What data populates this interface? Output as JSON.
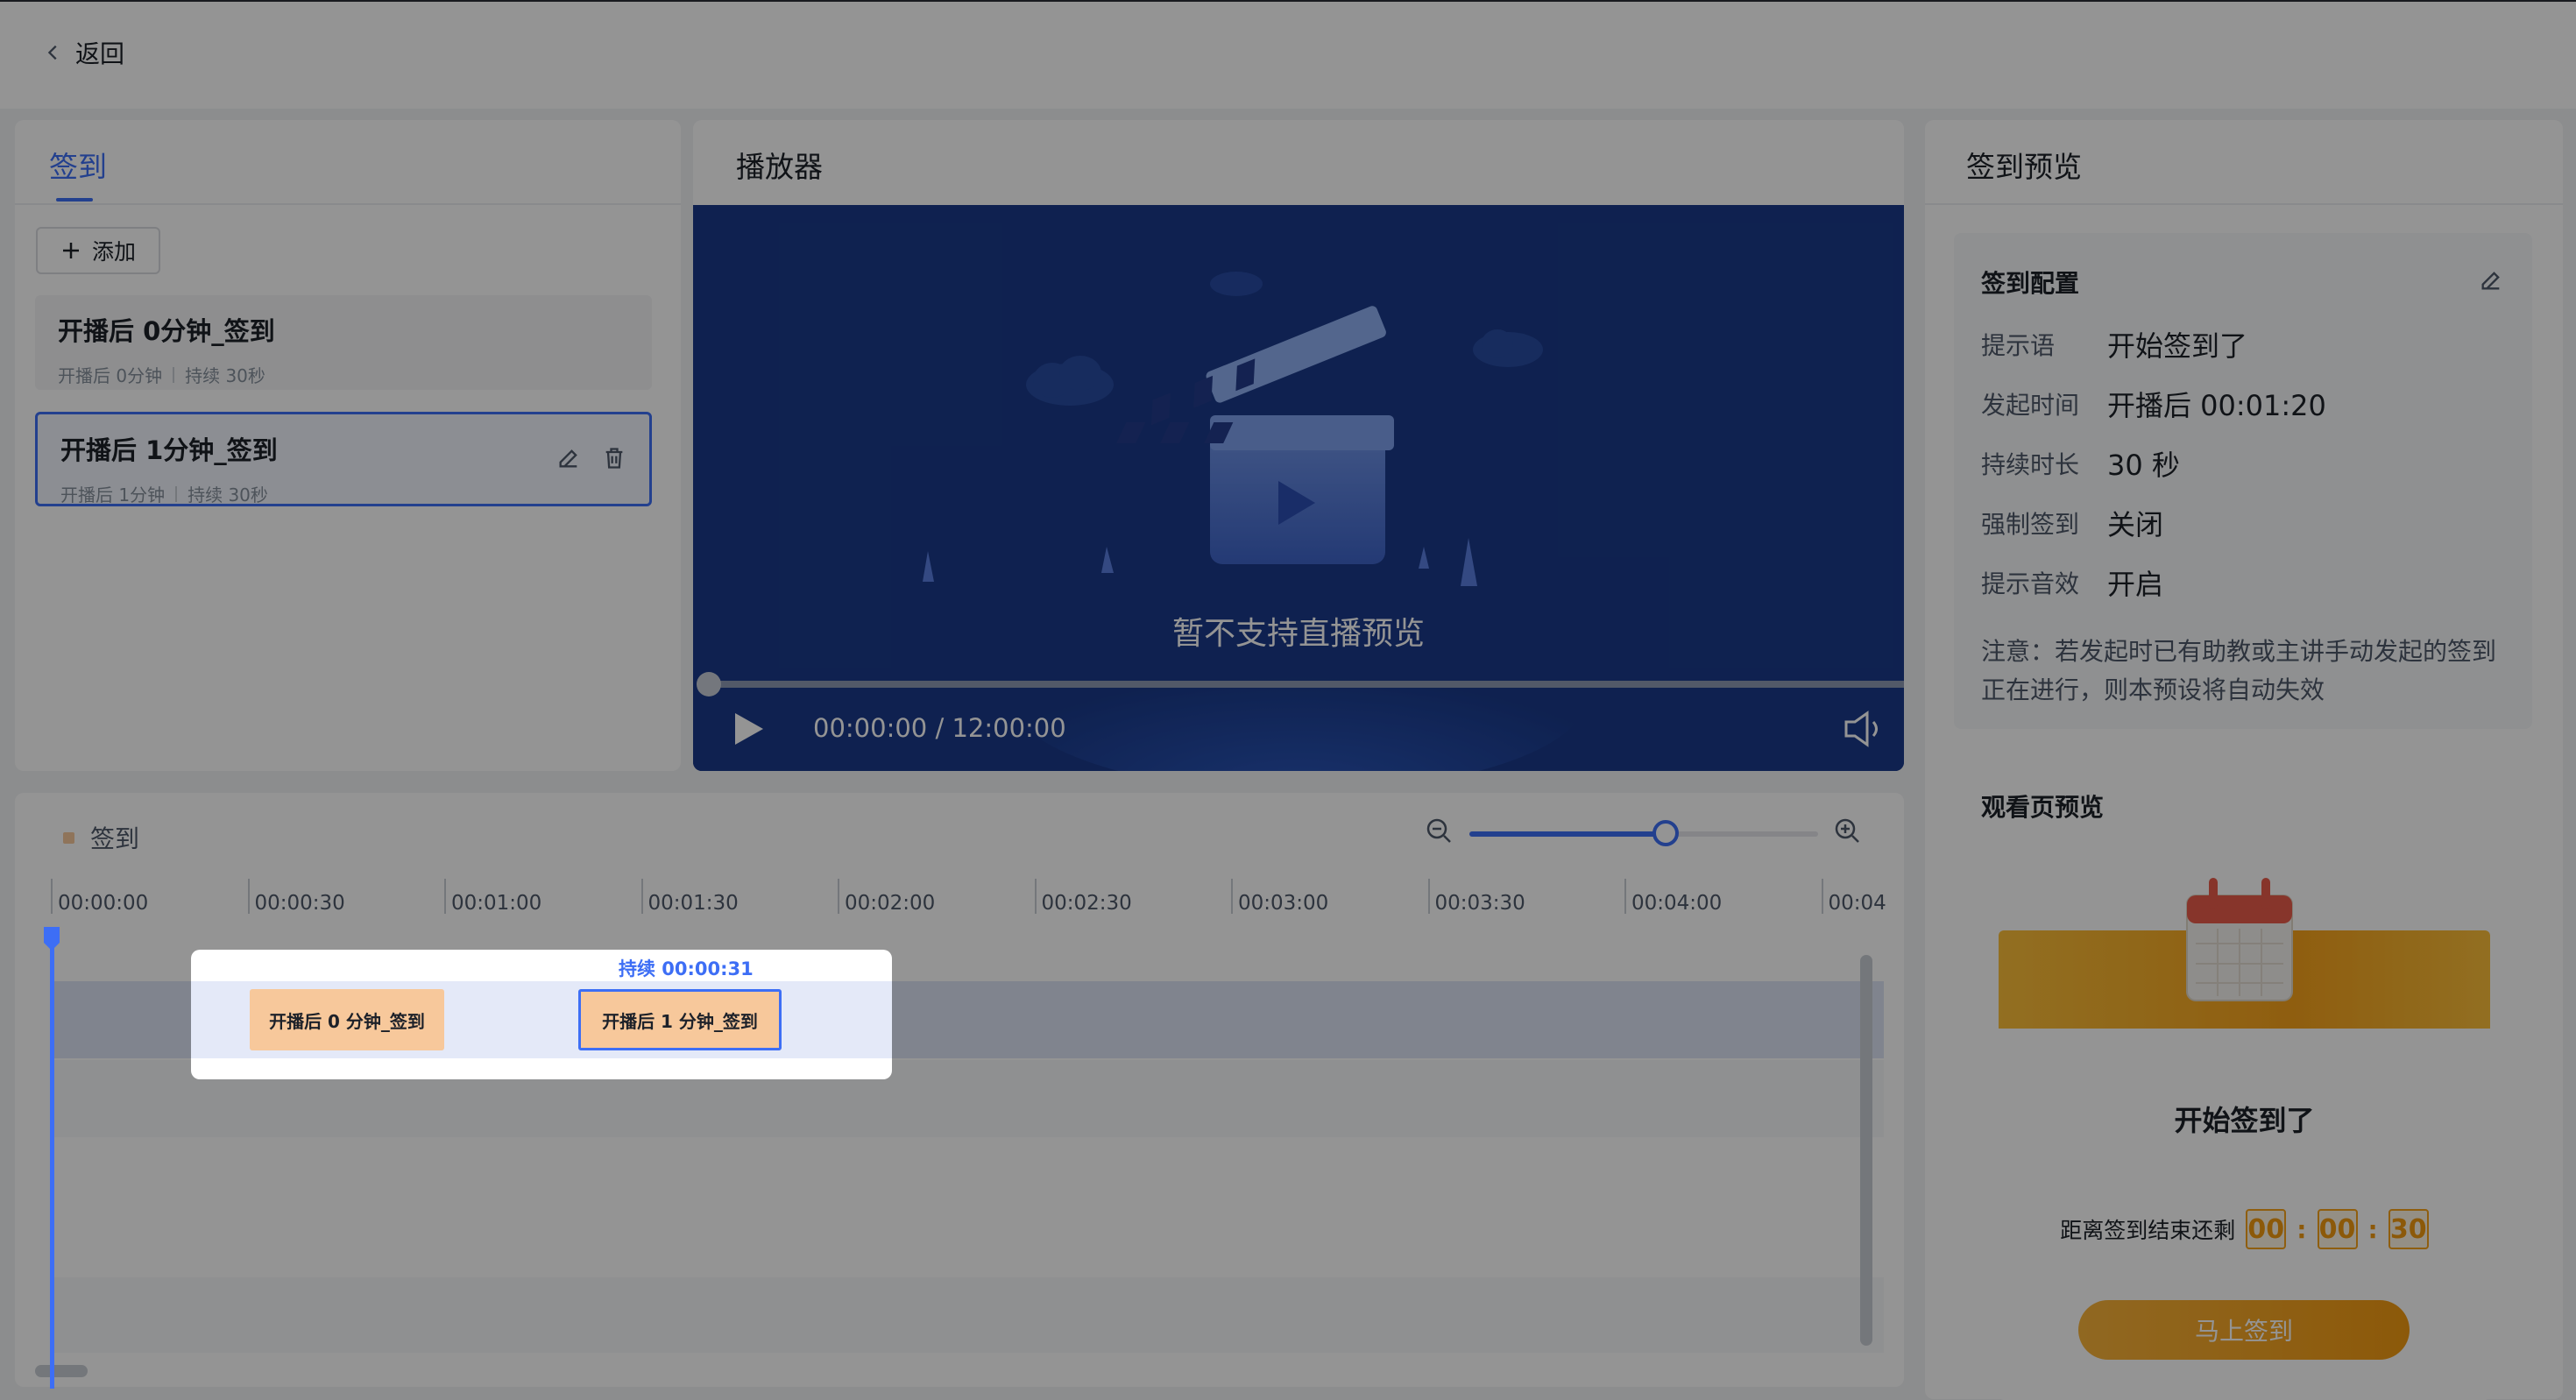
{
  "header": {
    "back_label": "返回"
  },
  "left_panel": {
    "tab_label": "签到",
    "add_label": "添加",
    "items": [
      {
        "title": "开播后 0分钟_签到",
        "start": "开播后 0分钟",
        "duration": "持续 30秒"
      },
      {
        "title": "开播后 1分钟_签到",
        "start": "开播后 1分钟",
        "duration": "持续 30秒"
      }
    ]
  },
  "player": {
    "title": "播放器",
    "message": "暂不支持直播预览",
    "time": "00:00:00 / 12:00:00",
    "progress": 0
  },
  "right_panel": {
    "title": "签到预览",
    "config": {
      "title": "签到配置",
      "rows": [
        {
          "label": "提示语",
          "value": "开始签到了"
        },
        {
          "label": "发起时间",
          "value": "开播后 00:01:20"
        },
        {
          "label": "持续时长",
          "value": "30 秒"
        },
        {
          "label": "强制签到",
          "value": "关闭"
        },
        {
          "label": "提示音效",
          "value": "开启"
        }
      ],
      "note": "注意：若发起时已有助教或主讲手动发起的签到正在进行，则本预设将自动失效"
    },
    "watch": {
      "title": "观看页预览",
      "message": "开始签到了",
      "countdown_label": "距离签到结束还剩",
      "countdown": [
        "00",
        "00",
        "30"
      ],
      "button_label": "马上签到"
    }
  },
  "timeline": {
    "legend": "签到",
    "zoom_level": 0.57,
    "ticks": [
      "00:00:00",
      "00:00:30",
      "00:01:00",
      "00:01:30",
      "00:02:00",
      "00:02:30",
      "00:03:00",
      "00:03:30",
      "00:04:00",
      "00:04"
    ],
    "duration_tip": "持续 00:00:31",
    "blocks": [
      {
        "label": "开播后 0 分钟_签到"
      },
      {
        "label": "开播后 1 分钟_签到"
      }
    ]
  },
  "colors": {
    "accent": "#3d6ef5",
    "block": "#f7c89b",
    "countdown": "#f29a11",
    "video_bg": "#1a3a8a"
  }
}
